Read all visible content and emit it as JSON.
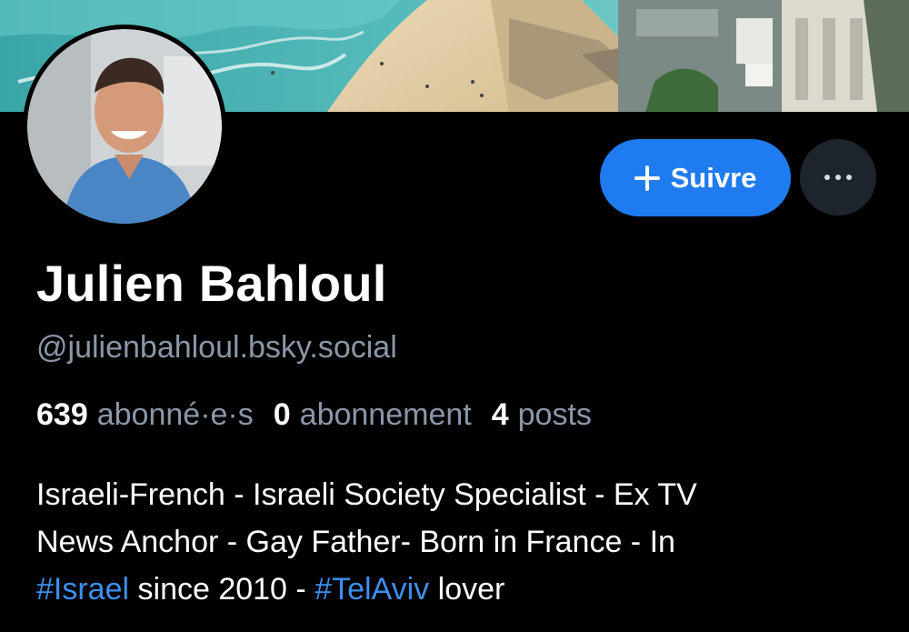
{
  "profile": {
    "display_name": "Julien Bahloul",
    "handle": "@julienbahloul.bsky.social",
    "stats": {
      "followers_count": "639",
      "followers_label": "abonné·e·s",
      "following_count": "0",
      "following_label": "abonnement",
      "posts_count": "4",
      "posts_label": "posts"
    },
    "bio": {
      "line1": "Israeli-French - Israeli Society Specialist - Ex TV",
      "line2": "News Anchor - Gay Father- Born in France - In",
      "hashtag1": "#Israel",
      "line3_mid": " since 2010 - ",
      "hashtag2": "#TelAviv",
      "line3_end": " lover"
    }
  },
  "actions": {
    "follow_label": "Suivre",
    "follow_icon": "plus-icon",
    "more_icon": "ellipsis-icon"
  },
  "colors": {
    "background": "#000000",
    "accent": "#1f7bf0",
    "hashtag": "#3d8ff0",
    "muted_text": "#8b97a8",
    "more_button_bg": "#1e242c"
  }
}
